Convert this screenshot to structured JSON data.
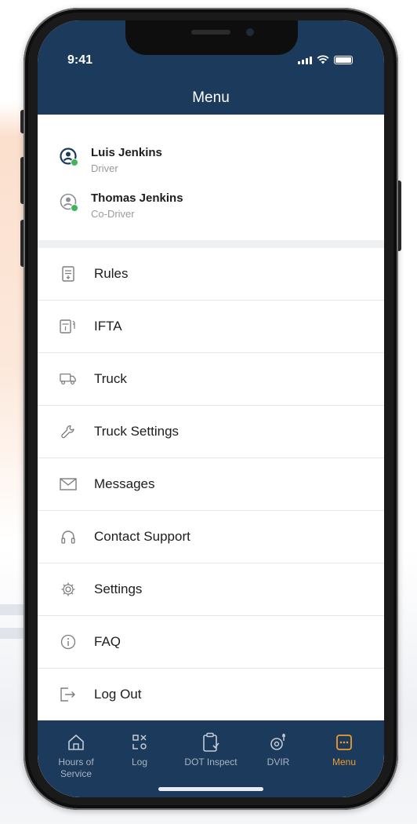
{
  "status_bar": {
    "time": "9:41"
  },
  "header": {
    "title": "Menu"
  },
  "drivers": [
    {
      "name": "Luis Jenkins",
      "role": "Driver"
    },
    {
      "name": "Thomas Jenkins",
      "role": "Co-Driver"
    }
  ],
  "menu": [
    {
      "label": "Rules",
      "icon": "rules-icon"
    },
    {
      "label": "IFTA",
      "icon": "fuel-receipt-icon"
    },
    {
      "label": "Truck",
      "icon": "truck-icon"
    },
    {
      "label": "Truck Settings",
      "icon": "wrench-icon"
    },
    {
      "label": "Messages",
      "icon": "envelope-icon"
    },
    {
      "label": "Contact Support",
      "icon": "headphones-icon"
    },
    {
      "label": "Settings",
      "icon": "gear-icon"
    },
    {
      "label": "FAQ",
      "icon": "info-icon"
    },
    {
      "label": "Log Out",
      "icon": "logout-icon"
    }
  ],
  "tabs": [
    {
      "label": "Hours of Service",
      "icon": "home-icon",
      "active": false
    },
    {
      "label": "Log",
      "icon": "log-grid-icon",
      "active": false
    },
    {
      "label": "DOT Inspect",
      "icon": "clipboard-check-icon",
      "active": false
    },
    {
      "label": "DVIR",
      "icon": "inspection-icon",
      "active": false
    },
    {
      "label": "Menu",
      "icon": "menu-icon",
      "active": true
    }
  ],
  "colors": {
    "header_bg": "#1b3a5c",
    "active_tab": "#f29a2e",
    "inactive_tab": "#aab4c0",
    "online_dot": "#3fb55c"
  }
}
